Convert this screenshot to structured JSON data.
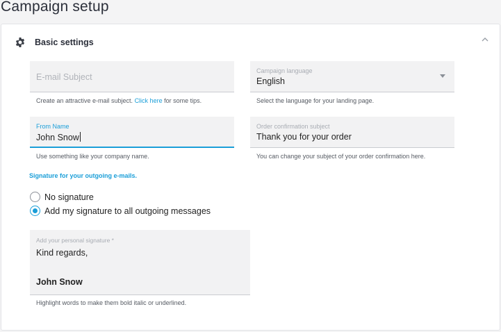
{
  "page": {
    "title": "Campaign setup"
  },
  "section": {
    "title": "Basic settings",
    "collapse_icon": "chevron-up-icon",
    "settings_icon": "gear-icon"
  },
  "fields": {
    "email_subject": {
      "placeholder": "E-mail Subject",
      "value": "",
      "helper_prefix": "Create an attractive e-mail subject. ",
      "helper_link": "Click here",
      "helper_suffix": " for some tips."
    },
    "campaign_language": {
      "label": "Campaign language",
      "value": "English",
      "helper": "Select the language for your landing page."
    },
    "from_name": {
      "label": "From Name",
      "value": "John Snow",
      "helper": "Use something like your company name."
    },
    "order_confirmation_subject": {
      "label": "Order confirmation subject",
      "value": "Thank you for your order",
      "helper": "You can change your subject of your order confirmation here."
    }
  },
  "signature": {
    "heading": "Signature for your outgoing e-mails.",
    "options": [
      {
        "label": "No signature",
        "checked": false
      },
      {
        "label": "Add my signature to all outgoing messages",
        "checked": true
      }
    ],
    "field_label": "Add your personal signature *",
    "line1": "Kind regards,",
    "line2": "John Snow",
    "helper": "Highlight words to make them bold italic or underlined."
  },
  "colors": {
    "accent": "#1a9ed8",
    "field_bg": "#f2f2f3",
    "page_bg": "#f4f4f5"
  }
}
